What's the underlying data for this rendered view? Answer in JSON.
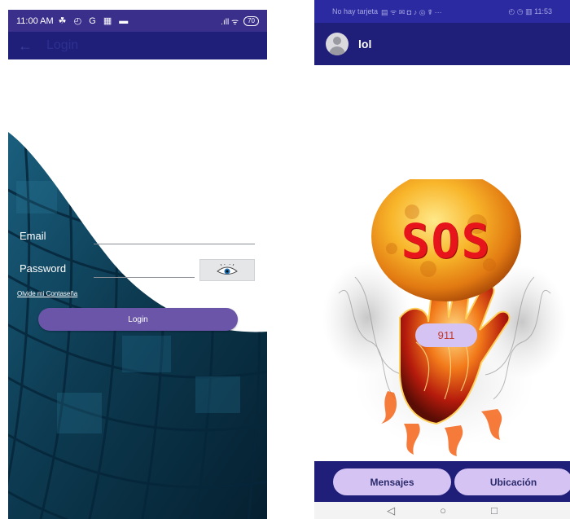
{
  "left_screen": {
    "status_bar": {
      "time": "11:00 AM",
      "status_icons": "☘ ◴ G ▦ ▬",
      "signal_icons": ".ıll ᯤ",
      "battery": "70"
    },
    "app_bar": {
      "title": "Login"
    },
    "form": {
      "email_label": "Email",
      "password_label": "Password",
      "forgot_link": "Olvide mi Contaseña",
      "login_button": "Login"
    }
  },
  "right_screen": {
    "status_bar": {
      "carrier": "No hay tarjeta",
      "notif_icons": "▤ ᯤ ✉ ◘ ♪ ◎ ☤ ···",
      "right_text": "◴ ◷ ▥ 11:53"
    },
    "app_bar": {
      "user_name": "lol"
    },
    "sos_text": "SOS",
    "call_button": "911",
    "bottom_bar": {
      "messages_button": "Mensajes",
      "location_button": "Ubicación"
    },
    "nav": {
      "back": "◁",
      "home": "○",
      "recents": "□"
    }
  },
  "colors": {
    "status_bar_left": "#3b2f8c",
    "app_bar": "#1f1f7a",
    "login_button": "#6a55a8",
    "pill_buttons": "#d4c3f3",
    "sos_red": "#e8141c"
  }
}
